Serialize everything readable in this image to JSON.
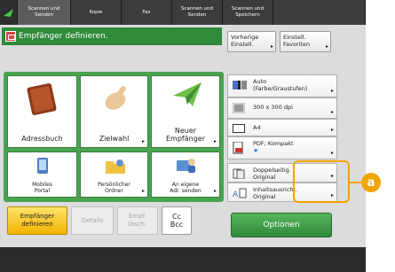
{
  "tabs": {
    "scan_send": [
      "Scannen und",
      "Senden"
    ],
    "copy": "Kopie",
    "fax": "Fax",
    "scan_send_2": [
      "Scannen und",
      "Senden"
    ],
    "scan_save": [
      "Scannen und",
      "Speichern"
    ]
  },
  "header": {
    "title": "Empfänger definieren."
  },
  "top_right": {
    "prev_settings": [
      "Vorherige",
      "Einstell."
    ],
    "favorites": [
      "Einstell.",
      "Favoriten"
    ]
  },
  "tiles": {
    "address_book": "Adressbuch",
    "speed_dial": "Zielwahl",
    "new_recipient": [
      "Neuer",
      "Empfänger"
    ],
    "mobile_portal": [
      "Mobiles",
      "Portal"
    ],
    "personal_folder": [
      "Persönlicher",
      "Ordner"
    ],
    "send_to_self": [
      "An eigene",
      "Adr. senden"
    ]
  },
  "bottom": {
    "define_recipient": [
      "Empfänger",
      "definieren"
    ],
    "details": "Details",
    "delete_recipient": [
      "Empf.",
      "lösch."
    ],
    "cc_bcc": [
      "Cc",
      "Bcc"
    ]
  },
  "settings": {
    "color": [
      "Auto",
      "(Farbe/Graustufen)"
    ],
    "resolution": "300 x 300 dpi",
    "paper_size": "A4",
    "file_format": [
      "PDF; Kompakt"
    ],
    "duplex": [
      "Doppelseitig.",
      "Original"
    ],
    "content_type": [
      "Inhaltsausricht.",
      "Original"
    ]
  },
  "options_label": "Optionen",
  "callout_label": "a",
  "colors": {
    "accent_green": "#4aa34f",
    "highlight": "#f0a500",
    "yellow_button": "#f2b300"
  }
}
